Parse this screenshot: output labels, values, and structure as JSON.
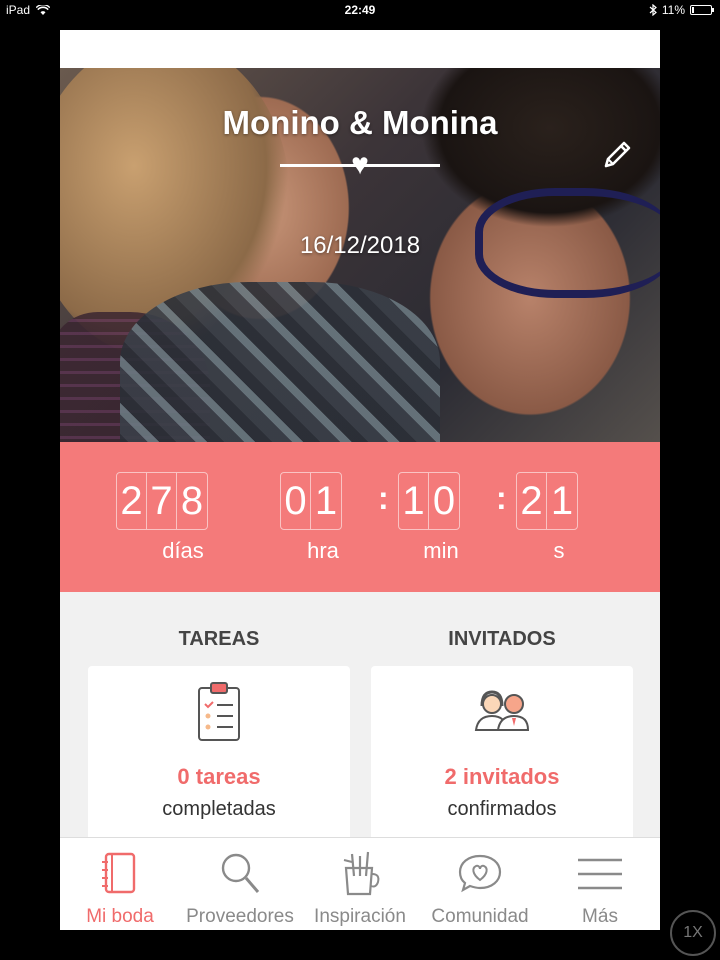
{
  "status_bar": {
    "device": "iPad",
    "time": "22:49",
    "battery": "11%",
    "battery_level": 0.11
  },
  "hero": {
    "couple": "Monino & Monina",
    "date": "16/12/2018"
  },
  "countdown": {
    "days": [
      "2",
      "7",
      "8"
    ],
    "hours": [
      "0",
      "1"
    ],
    "minutes": [
      "1",
      "0"
    ],
    "seconds": [
      "2",
      "1"
    ],
    "separator": ":",
    "units": {
      "days": "días",
      "hours": "hra",
      "minutes": "min",
      "seconds": "s"
    }
  },
  "tasks": {
    "title": "TAREAS",
    "count": "0 tareas",
    "label": "completadas"
  },
  "guests": {
    "title": "INVITADOS",
    "count": "2 invitados",
    "label": "confirmados"
  },
  "tabs": [
    {
      "label": "Mi boda",
      "icon": "notebook-icon",
      "active": true
    },
    {
      "label": "Proveedores",
      "icon": "search-icon"
    },
    {
      "label": "Inspiración",
      "icon": "tools-cup-icon"
    },
    {
      "label": "Comunidad",
      "icon": "heart-bubble-icon"
    },
    {
      "label": "Más",
      "icon": "menu-icon"
    }
  ],
  "zoom": {
    "label": "1X"
  },
  "colors": {
    "accent": "#f47a7a",
    "accent_text": "#f06b6b",
    "background": "#f1f1f1"
  }
}
